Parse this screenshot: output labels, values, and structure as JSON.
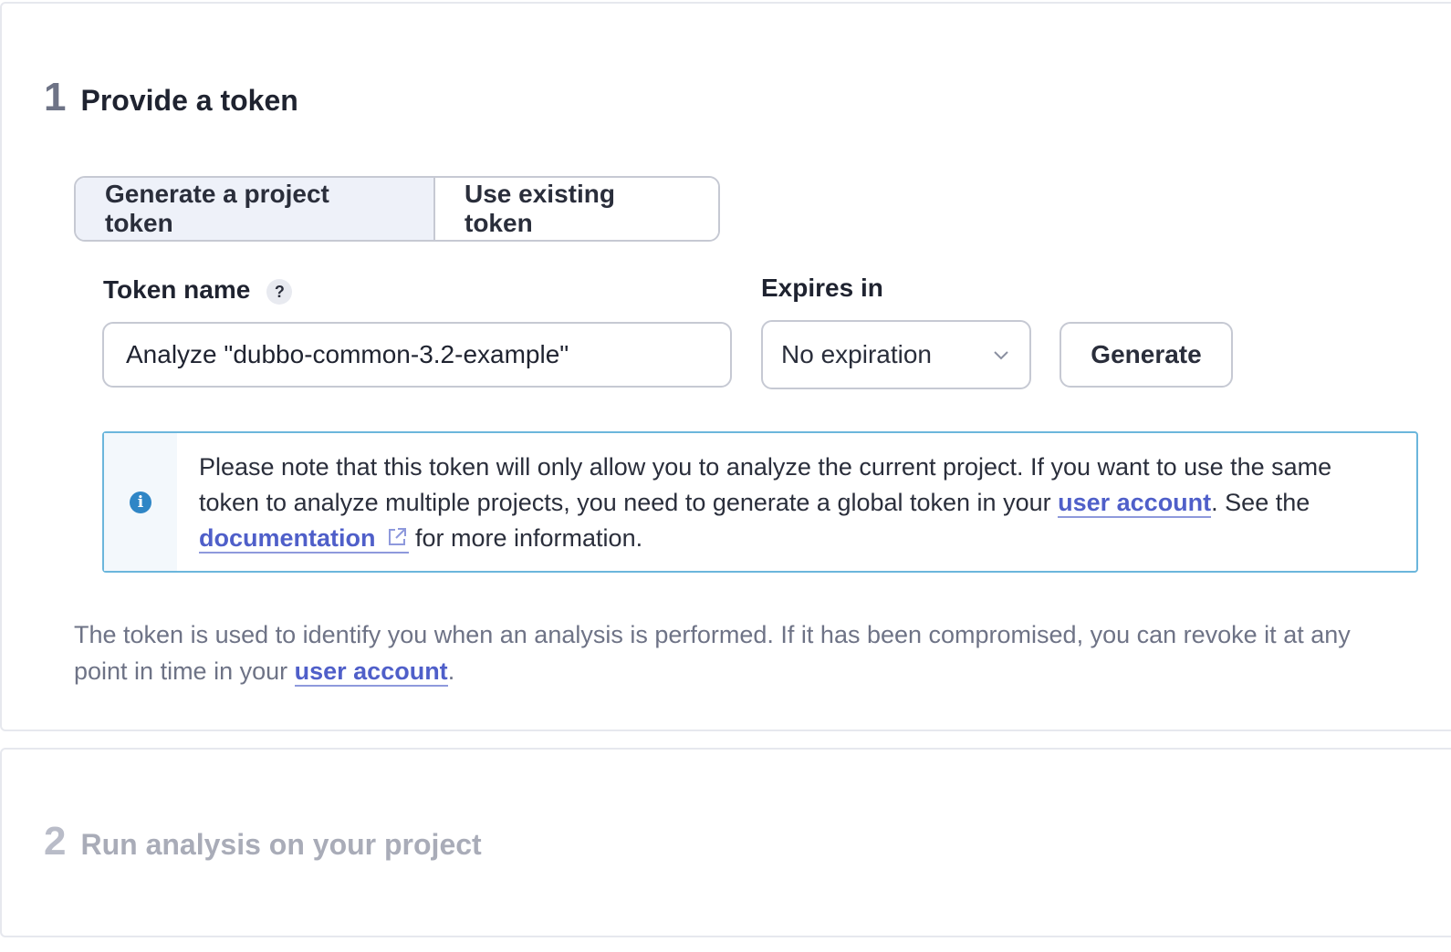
{
  "step1": {
    "number": "1",
    "title": "Provide a token",
    "mode_toggle": {
      "options": [
        "Generate a project token",
        "Use existing token"
      ],
      "selected": "Generate a project token"
    },
    "token_name": {
      "label": "Token name",
      "help_icon": "?",
      "value": "Analyze \"dubbo-common-3.2-example\""
    },
    "expires": {
      "label": "Expires in",
      "value": "No expiration"
    },
    "generate_label": "Generate",
    "info": {
      "icon": "i",
      "text_1": "Please note that this token will only allow you to analyze the current project. If you want to use the same token to analyze multiple projects, you need to generate a global token in your ",
      "link_1": "user account",
      "text_2": ". See the ",
      "link_2": "documentation",
      "text_3": " for more information."
    },
    "footnote": {
      "text_1": "The token is used to identify you when an analysis is performed. If it has been compromised, you can revoke it at any point in time in your ",
      "link": "user account",
      "text_2": "."
    }
  },
  "step2": {
    "number": "2",
    "title": "Run analysis on your project"
  },
  "colors": {
    "link": "#4f5fc9",
    "info_border": "#6bb6dc",
    "info_icon": "#2f86c6",
    "toggle_active_bg": "#eef1f9",
    "muted_text": "#6e7386"
  },
  "icons": {
    "help": "question-mark-icon",
    "dropdown": "chevron-down-icon",
    "info": "info-icon",
    "external": "external-link-icon"
  }
}
